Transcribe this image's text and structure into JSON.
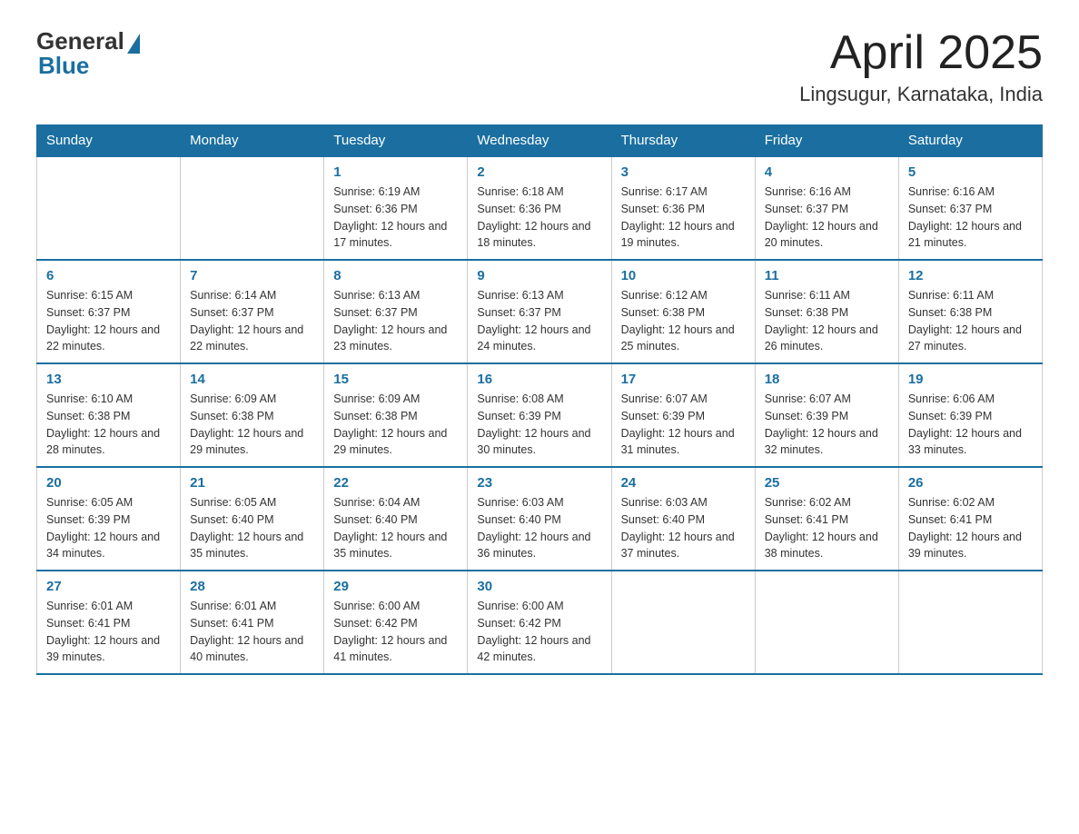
{
  "header": {
    "logo_general": "General",
    "logo_blue": "Blue",
    "month_title": "April 2025",
    "location": "Lingsugur, Karnataka, India"
  },
  "days_of_week": [
    "Sunday",
    "Monday",
    "Tuesday",
    "Wednesday",
    "Thursday",
    "Friday",
    "Saturday"
  ],
  "weeks": [
    [
      {
        "day": "",
        "info": ""
      },
      {
        "day": "",
        "info": ""
      },
      {
        "day": "1",
        "info": "Sunrise: 6:19 AM\nSunset: 6:36 PM\nDaylight: 12 hours\nand 17 minutes."
      },
      {
        "day": "2",
        "info": "Sunrise: 6:18 AM\nSunset: 6:36 PM\nDaylight: 12 hours\nand 18 minutes."
      },
      {
        "day": "3",
        "info": "Sunrise: 6:17 AM\nSunset: 6:36 PM\nDaylight: 12 hours\nand 19 minutes."
      },
      {
        "day": "4",
        "info": "Sunrise: 6:16 AM\nSunset: 6:37 PM\nDaylight: 12 hours\nand 20 minutes."
      },
      {
        "day": "5",
        "info": "Sunrise: 6:16 AM\nSunset: 6:37 PM\nDaylight: 12 hours\nand 21 minutes."
      }
    ],
    [
      {
        "day": "6",
        "info": "Sunrise: 6:15 AM\nSunset: 6:37 PM\nDaylight: 12 hours\nand 22 minutes."
      },
      {
        "day": "7",
        "info": "Sunrise: 6:14 AM\nSunset: 6:37 PM\nDaylight: 12 hours\nand 22 minutes."
      },
      {
        "day": "8",
        "info": "Sunrise: 6:13 AM\nSunset: 6:37 PM\nDaylight: 12 hours\nand 23 minutes."
      },
      {
        "day": "9",
        "info": "Sunrise: 6:13 AM\nSunset: 6:37 PM\nDaylight: 12 hours\nand 24 minutes."
      },
      {
        "day": "10",
        "info": "Sunrise: 6:12 AM\nSunset: 6:38 PM\nDaylight: 12 hours\nand 25 minutes."
      },
      {
        "day": "11",
        "info": "Sunrise: 6:11 AM\nSunset: 6:38 PM\nDaylight: 12 hours\nand 26 minutes."
      },
      {
        "day": "12",
        "info": "Sunrise: 6:11 AM\nSunset: 6:38 PM\nDaylight: 12 hours\nand 27 minutes."
      }
    ],
    [
      {
        "day": "13",
        "info": "Sunrise: 6:10 AM\nSunset: 6:38 PM\nDaylight: 12 hours\nand 28 minutes."
      },
      {
        "day": "14",
        "info": "Sunrise: 6:09 AM\nSunset: 6:38 PM\nDaylight: 12 hours\nand 29 minutes."
      },
      {
        "day": "15",
        "info": "Sunrise: 6:09 AM\nSunset: 6:38 PM\nDaylight: 12 hours\nand 29 minutes."
      },
      {
        "day": "16",
        "info": "Sunrise: 6:08 AM\nSunset: 6:39 PM\nDaylight: 12 hours\nand 30 minutes."
      },
      {
        "day": "17",
        "info": "Sunrise: 6:07 AM\nSunset: 6:39 PM\nDaylight: 12 hours\nand 31 minutes."
      },
      {
        "day": "18",
        "info": "Sunrise: 6:07 AM\nSunset: 6:39 PM\nDaylight: 12 hours\nand 32 minutes."
      },
      {
        "day": "19",
        "info": "Sunrise: 6:06 AM\nSunset: 6:39 PM\nDaylight: 12 hours\nand 33 minutes."
      }
    ],
    [
      {
        "day": "20",
        "info": "Sunrise: 6:05 AM\nSunset: 6:39 PM\nDaylight: 12 hours\nand 34 minutes."
      },
      {
        "day": "21",
        "info": "Sunrise: 6:05 AM\nSunset: 6:40 PM\nDaylight: 12 hours\nand 35 minutes."
      },
      {
        "day": "22",
        "info": "Sunrise: 6:04 AM\nSunset: 6:40 PM\nDaylight: 12 hours\nand 35 minutes."
      },
      {
        "day": "23",
        "info": "Sunrise: 6:03 AM\nSunset: 6:40 PM\nDaylight: 12 hours\nand 36 minutes."
      },
      {
        "day": "24",
        "info": "Sunrise: 6:03 AM\nSunset: 6:40 PM\nDaylight: 12 hours\nand 37 minutes."
      },
      {
        "day": "25",
        "info": "Sunrise: 6:02 AM\nSunset: 6:41 PM\nDaylight: 12 hours\nand 38 minutes."
      },
      {
        "day": "26",
        "info": "Sunrise: 6:02 AM\nSunset: 6:41 PM\nDaylight: 12 hours\nand 39 minutes."
      }
    ],
    [
      {
        "day": "27",
        "info": "Sunrise: 6:01 AM\nSunset: 6:41 PM\nDaylight: 12 hours\nand 39 minutes."
      },
      {
        "day": "28",
        "info": "Sunrise: 6:01 AM\nSunset: 6:41 PM\nDaylight: 12 hours\nand 40 minutes."
      },
      {
        "day": "29",
        "info": "Sunrise: 6:00 AM\nSunset: 6:42 PM\nDaylight: 12 hours\nand 41 minutes."
      },
      {
        "day": "30",
        "info": "Sunrise: 6:00 AM\nSunset: 6:42 PM\nDaylight: 12 hours\nand 42 minutes."
      },
      {
        "day": "",
        "info": ""
      },
      {
        "day": "",
        "info": ""
      },
      {
        "day": "",
        "info": ""
      }
    ]
  ]
}
